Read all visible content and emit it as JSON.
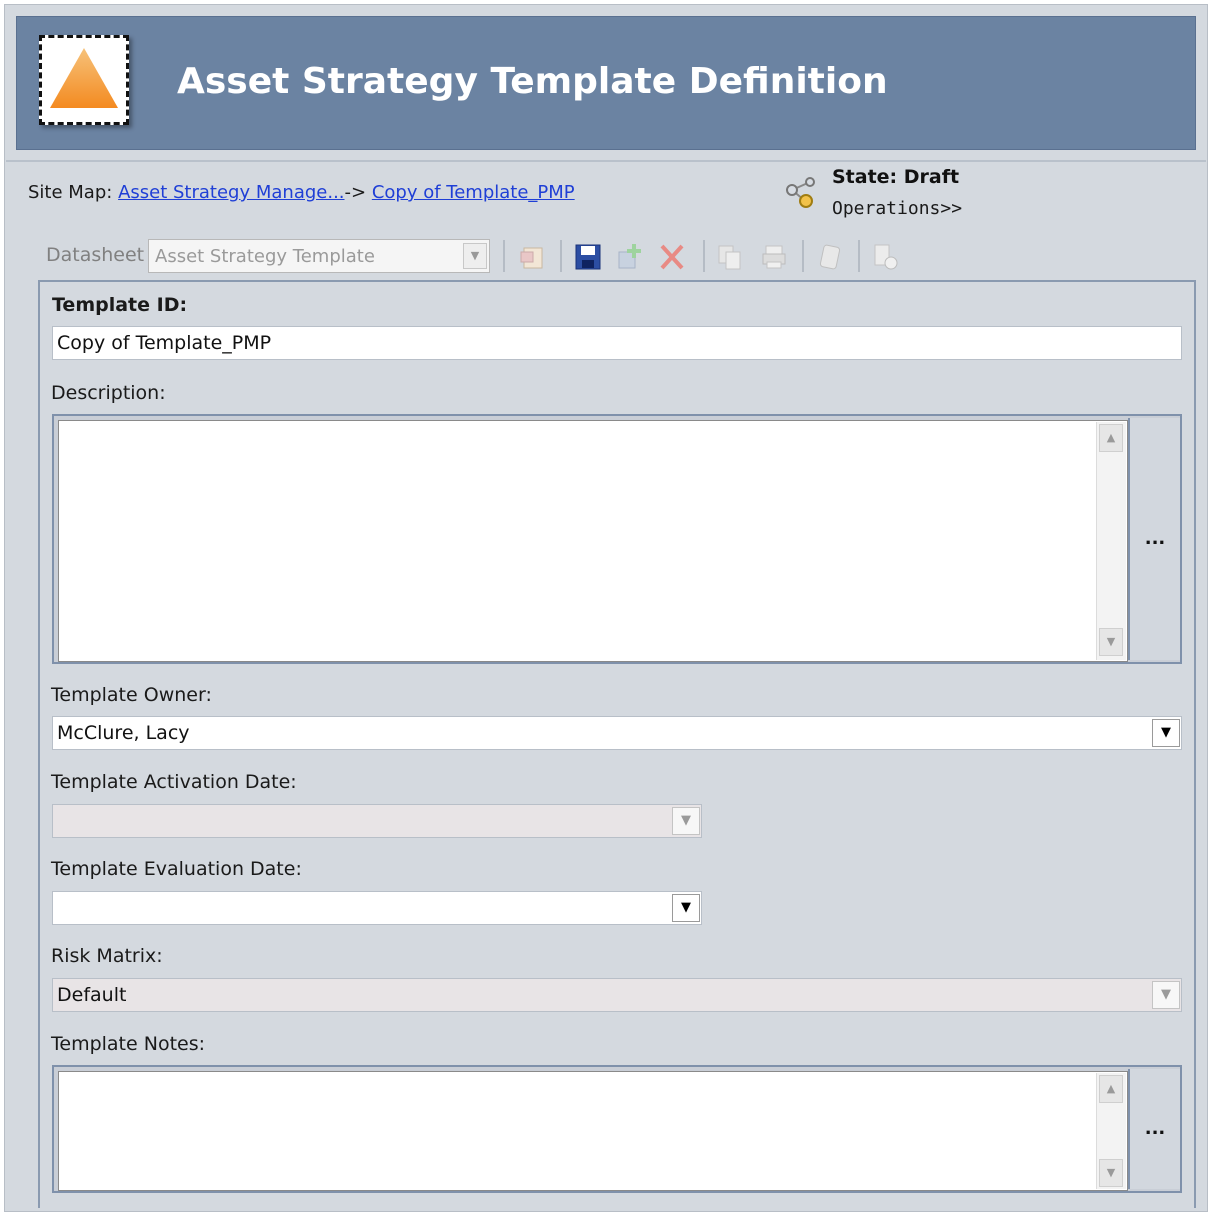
{
  "header": {
    "title": "Asset Strategy Template Definition"
  },
  "sitemap": {
    "prefix": "Site Map:",
    "crumb1": "Asset Strategy Manage...",
    "separator": "->",
    "crumb2": "Copy of Template_PMP"
  },
  "state": {
    "label": "State: Draft",
    "operations": "Operations>>"
  },
  "toolbar": {
    "datasheet_label": "Datasheet",
    "datasheet_value": "Asset Strategy Template"
  },
  "form": {
    "template_id": {
      "label": "Template ID:",
      "value": "Copy of Template_PMP"
    },
    "description": {
      "label": "Description:",
      "value": "",
      "ellipsis": "..."
    },
    "owner": {
      "label": "Template Owner:",
      "value": "McClure, Lacy"
    },
    "activation_date": {
      "label": "Template Activation Date:",
      "value": ""
    },
    "evaluation_date": {
      "label": "Template Evaluation Date:",
      "value": ""
    },
    "risk_matrix": {
      "label": "Risk Matrix:",
      "value": "Default"
    },
    "notes": {
      "label": "Template Notes:",
      "value": "",
      "ellipsis": "..."
    }
  },
  "colors": {
    "header_bg": "#6b83a2",
    "page_bg": "#d4d9df",
    "link": "#1f3fd6",
    "logo_triangle": "#f5a040"
  },
  "icons": [
    "warning-triangle-logo-icon",
    "state-workflow-icon",
    "new-document-icon",
    "save-icon",
    "add-child-icon",
    "delete-icon",
    "copy-icon",
    "print-icon",
    "attach-icon",
    "report-icon"
  ]
}
